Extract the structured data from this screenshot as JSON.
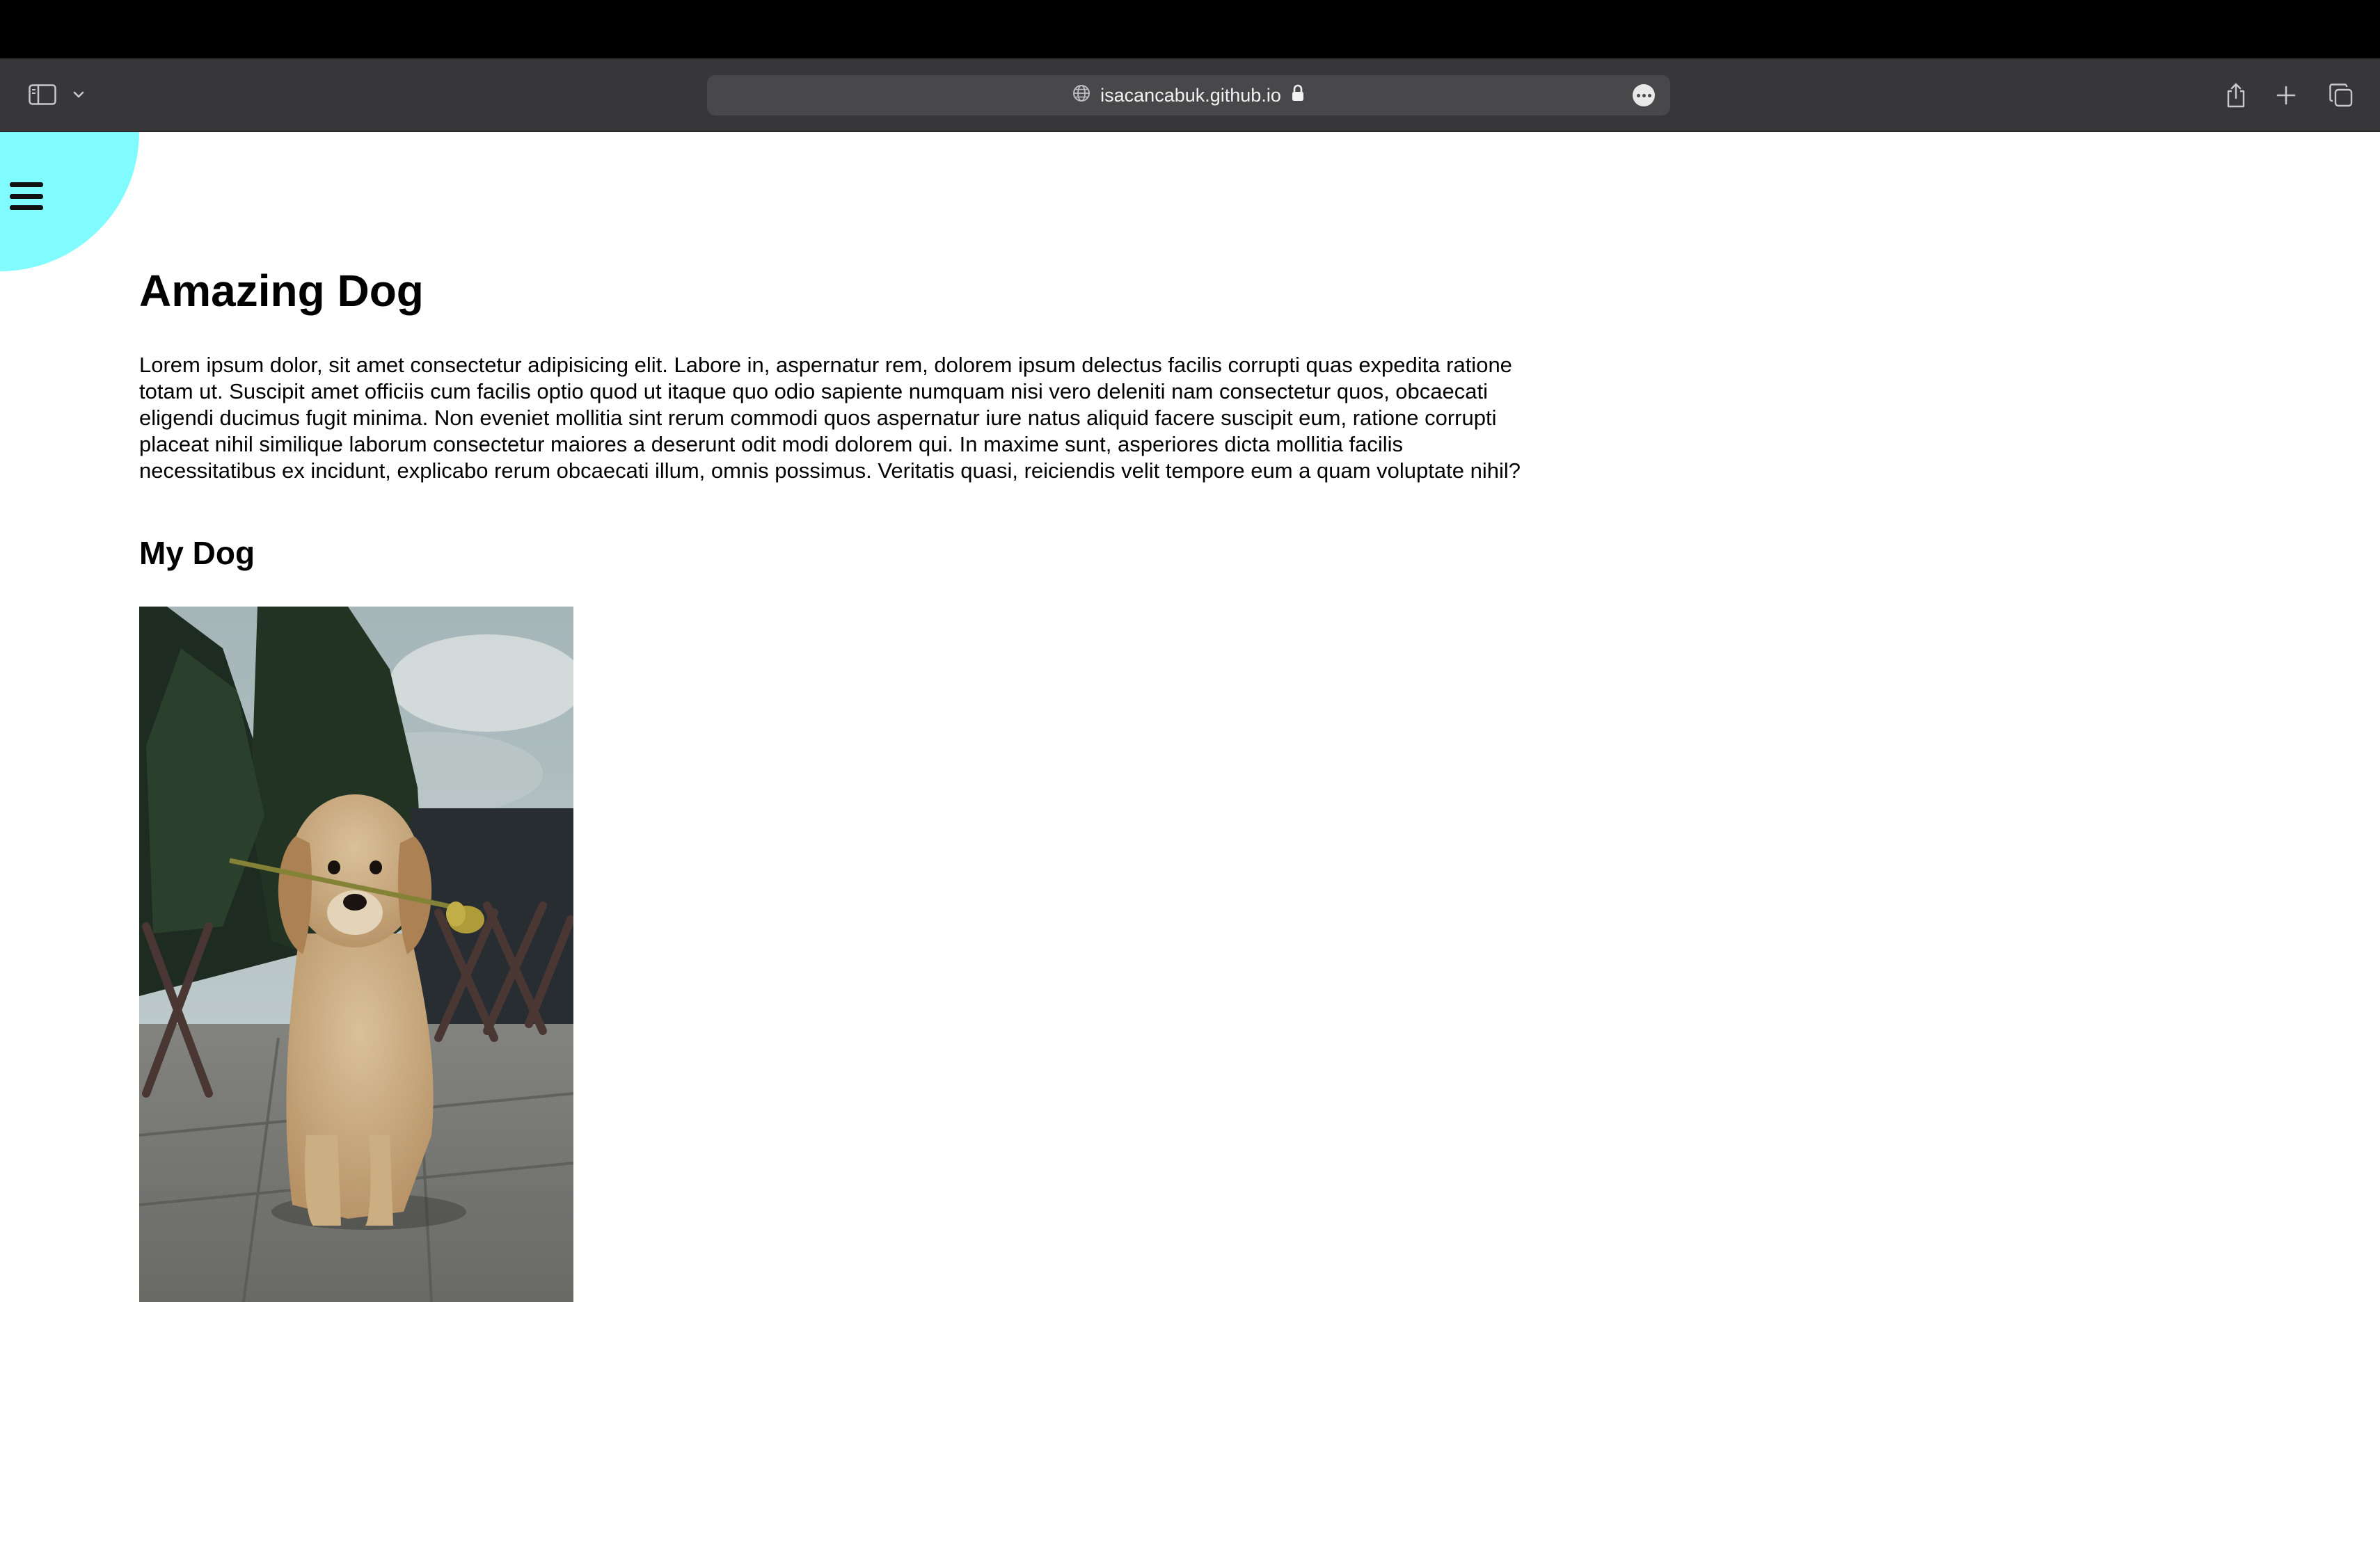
{
  "browser": {
    "url": "isacancabuk.github.io",
    "icons": {
      "sidebar": "sidebar-icon",
      "tab_overview": "chevron-down-icon",
      "site": "globe-icon",
      "secure": "lock-icon",
      "more": "more-icon",
      "share": "share-icon",
      "new_tab": "plus-icon",
      "tabs": "tabs-overview-icon"
    }
  },
  "page": {
    "menu_icon": "hamburger-icon",
    "accent_color": "#80fbff",
    "title": "Amazing Dog",
    "intro": "Lorem ipsum dolor, sit amet consectetur adipisicing elit. Labore in, aspernatur rem, dolorem ipsum delectus facilis corrupti quas expedita ratione totam ut. Suscipit amet officiis cum facilis optio quod ut itaque quo odio sapiente numquam nisi vero deleniti nam consectetur quos, obcaecati eligendi ducimus fugit minima. Non eveniet mollitia sint rerum commodi quos aspernatur iure natus aliquid facere suscipit eum, ratione corrupti placeat nihil similique laborum consectetur maiores a deserunt odit modi dolorem qui. In maxime sunt, asperiores dicta mollitia facilis necessitatibus ex incidunt, explicabo rerum obcaecati illum, omnis possimus. Veritatis quasi, reiciendis velit tempore eum a quam voluptate nihil?",
    "subtitle": "My Dog"
  }
}
